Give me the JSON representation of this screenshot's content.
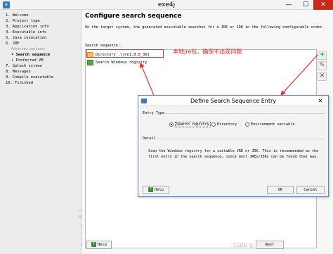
{
  "window": {
    "title": "exe4j",
    "minimize_glyph": "—",
    "maximize_glyph": "☐",
    "close_glyph": "✕"
  },
  "steps": [
    {
      "label": "1.  Welcome"
    },
    {
      "label": "2.  Project type"
    },
    {
      "label": "3.  Application info"
    },
    {
      "label": "4.  Executable info"
    },
    {
      "label": "5.  Java invocation"
    },
    {
      "label": "6.  JRE"
    },
    {
      "label": "Advanced options:"
    },
    {
      "label": "• Search sequence"
    },
    {
      "label": "• Preferred VM"
    },
    {
      "label": "7.  Splash screen"
    },
    {
      "label": "8.  Messages"
    },
    {
      "label": "9.  Compile executable"
    },
    {
      "label": "10. Finished"
    }
  ],
  "brand": "exe4j",
  "main": {
    "title": "Configure search sequence",
    "description": "On the target system, the generated executable searches for a JRE or JDK in the following configurable order.",
    "search_label": "Search sequence:",
    "items": [
      {
        "label": "Directory .\\jre1.8.0_301",
        "icon": "folder-icon"
      },
      {
        "label": "Search Windows registry",
        "icon": "registry-icon"
      }
    ],
    "side_buttons": {
      "add": "+",
      "edit": "✎",
      "remove": "✕"
    }
  },
  "annotation": "本地jre包，确保不出现问题",
  "footer": {
    "help": "Help",
    "next": "Next",
    "watermark": "CSDN @"
  },
  "dialog": {
    "title": "Define Search Sequence Entry",
    "close_glyph": "✕",
    "entry_type_label": "Entry Type",
    "options": [
      {
        "label": "Search registry",
        "checked": true
      },
      {
        "label": "Directory",
        "checked": false
      },
      {
        "label": "Environment variable",
        "checked": false
      }
    ],
    "detail_label": "Detail",
    "detail_text": "Scan the Windows registry for a suitable JRE or JDK. This is recommended as the first entry in the search sequence, since most JREs/JDKs can be found that way.",
    "help": "Help",
    "ok": "OK",
    "cancel": "Cancel"
  },
  "colors": {
    "annotation": "#e02020",
    "dialog_border": "#5a86c8",
    "close_button": "#c42b1c"
  }
}
